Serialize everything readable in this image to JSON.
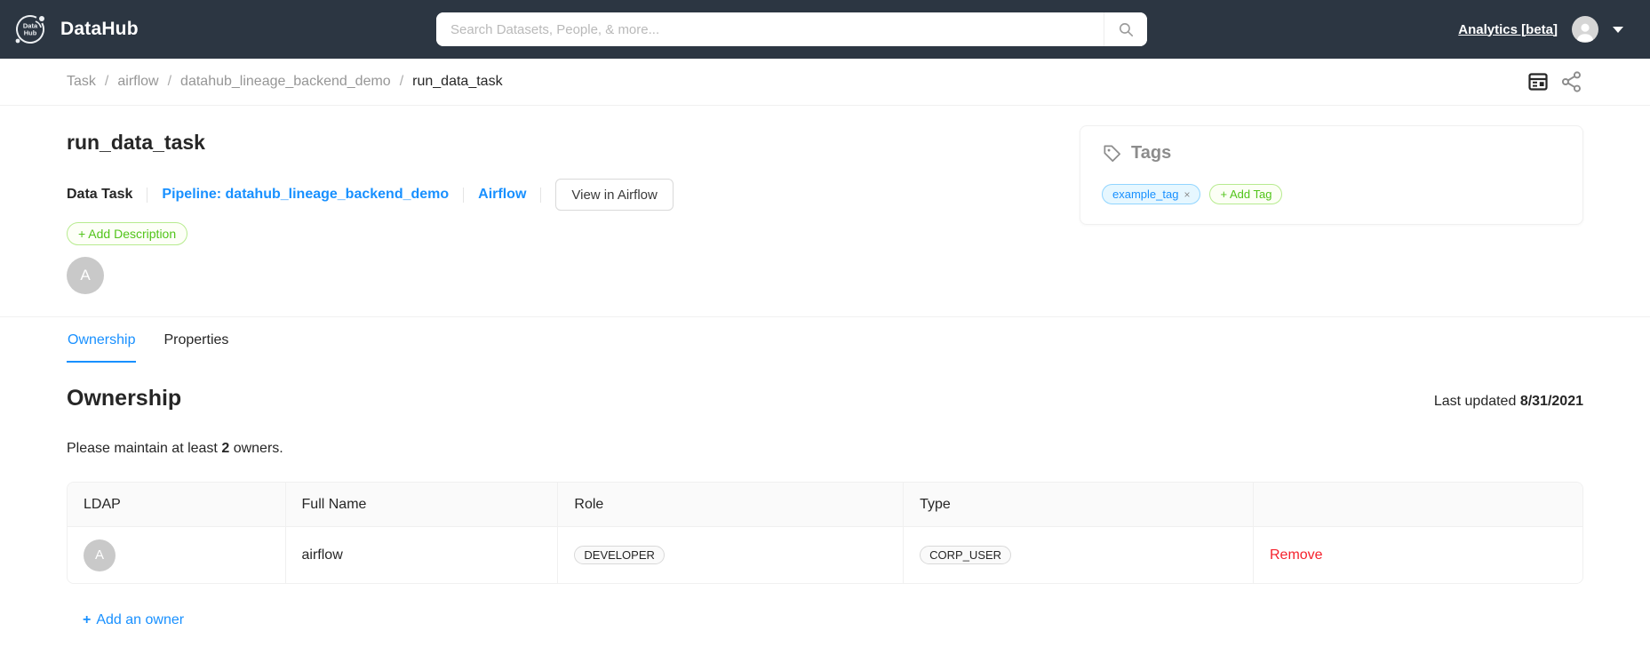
{
  "navbar": {
    "brand": "DataHub",
    "logo_text_top": "Data",
    "logo_text_bottom": "Hub",
    "search_placeholder": "Search Datasets, People, & more...",
    "analytics_label": "Analytics [beta]"
  },
  "breadcrumb": {
    "separator": "/",
    "items": [
      "Task",
      "airflow",
      "datahub_lineage_backend_demo",
      "run_data_task"
    ]
  },
  "entity": {
    "title": "run_data_task",
    "type_label": "Data Task",
    "pipeline_link": "Pipeline: datahub_lineage_backend_demo",
    "platform_link": "Airflow",
    "external_button": "View in Airflow",
    "add_description_label": "+ Add Description",
    "owner_avatar_letter": "A"
  },
  "tags": {
    "title": "Tags",
    "items": [
      {
        "label": "example_tag",
        "close": "×"
      }
    ],
    "add_label": "+ Add Tag"
  },
  "tabs": [
    {
      "label": "Ownership",
      "active": true
    },
    {
      "label": "Properties",
      "active": false
    }
  ],
  "ownership": {
    "heading": "Ownership",
    "last_updated_label": "Last updated",
    "last_updated_date": "8/31/2021",
    "note_prefix": "Please maintain at least",
    "note_count": "2",
    "note_suffix": "owners.",
    "table": {
      "headers": [
        "LDAP",
        "Full Name",
        "Role",
        "Type",
        ""
      ],
      "rows": [
        {
          "avatar_letter": "A",
          "full_name": "airflow",
          "role": "DEVELOPER",
          "type": "CORP_USER",
          "action": "Remove"
        }
      ]
    },
    "add_owner_plus": "+",
    "add_owner_label": "Add an owner"
  },
  "icons": {
    "search": "magnifier",
    "user": "person-silhouette",
    "caret": "triangle-down",
    "details": "profile-card",
    "share": "share-nodes",
    "tag": "tag-outline"
  },
  "colors": {
    "navbar_bg": "#2c3642",
    "primary_blue": "#1890ff",
    "green": "#52c41a",
    "green_border": "#b7eb8f",
    "tag_blue_bg": "#e6f7ff",
    "tag_blue_border": "#91d5ff",
    "danger_red": "#f5222d",
    "text_dark": "#262626",
    "text_gray": "#8c8c8c",
    "border_light": "#f0f0f0",
    "border_mid": "#d9d9d9",
    "table_header_bg": "#fafafa",
    "avatar_gray": "#c9c9c9"
  }
}
